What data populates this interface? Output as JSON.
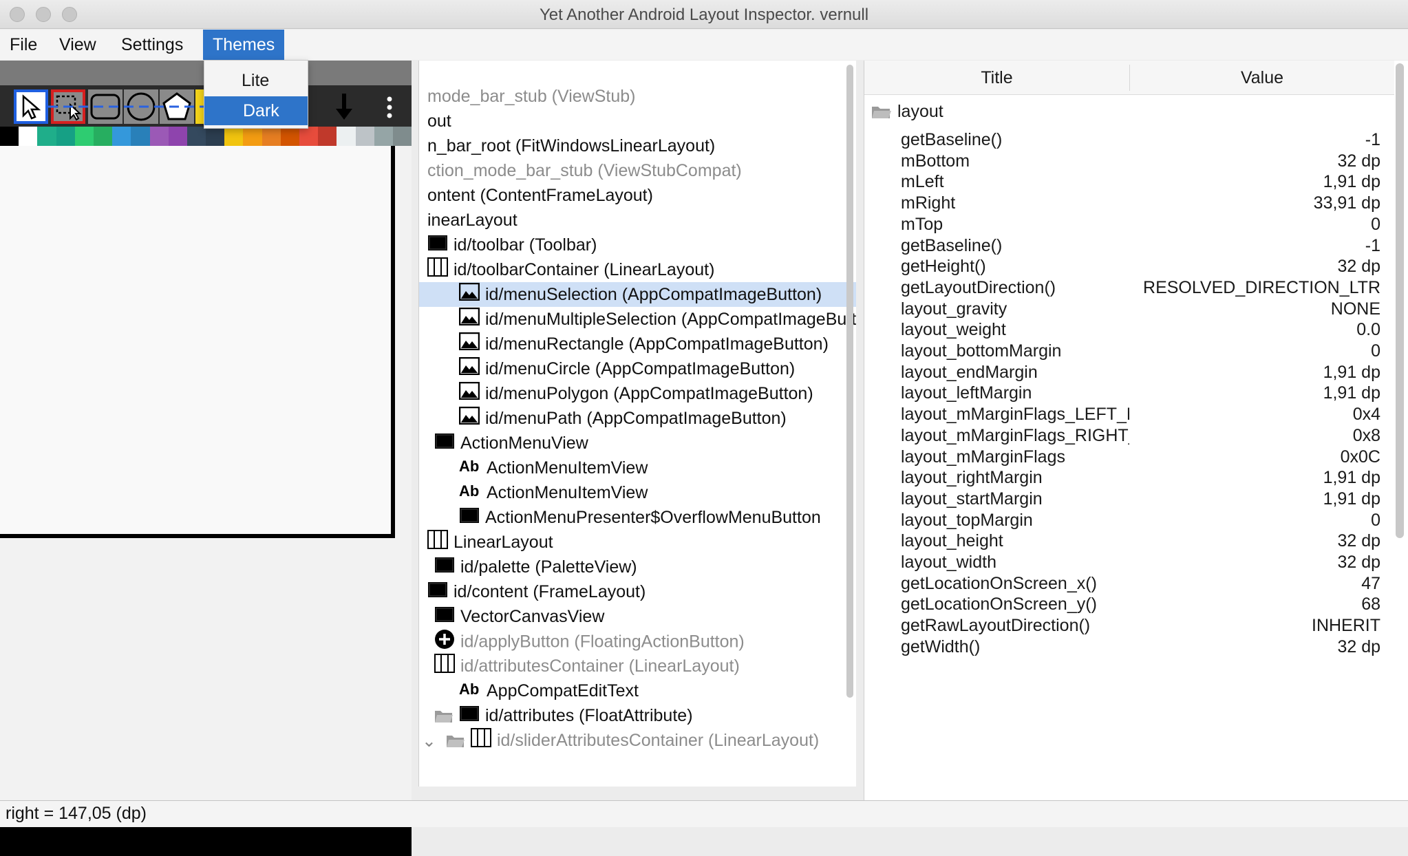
{
  "window": {
    "title": "Yet Another Android Layout Inspector. vernull"
  },
  "menubar": {
    "items": [
      "File",
      "View",
      "Settings",
      "Themes"
    ],
    "active": "Themes"
  },
  "themes_menu": {
    "items": [
      "Lite",
      "Dark"
    ],
    "selected": "Dark"
  },
  "palette_colors": [
    "#000000",
    "#ffffff",
    "#1fae8a",
    "#16a085",
    "#2ecc71",
    "#27ae60",
    "#3498db",
    "#2980b9",
    "#9b59b6",
    "#8e44ad",
    "#34495e",
    "#2c3e50",
    "#f1c40f",
    "#f39c12",
    "#e67e22",
    "#d35400",
    "#e74c3c",
    "#c0392b",
    "#ecf0f1",
    "#bdc3c7",
    "#95a5a6",
    "#7f8c8d"
  ],
  "tree": {
    "rows": [
      {
        "text": "mode_bar_stub (ViewStub)",
        "gray": true,
        "icon": ""
      },
      {
        "text": "out",
        "gray": false,
        "icon": ""
      },
      {
        "text": "n_bar_root (FitWindowsLinearLayout)",
        "gray": false,
        "icon": ""
      },
      {
        "text": "ction_mode_bar_stub (ViewStubCompat)",
        "gray": true,
        "icon": ""
      },
      {
        "text": "ontent (ContentFrameLayout)",
        "gray": false,
        "icon": ""
      },
      {
        "text": "inearLayout",
        "gray": false,
        "icon": ""
      },
      {
        "text": "id/toolbar (Toolbar)",
        "gray": false,
        "icon": "view-icon"
      },
      {
        "text": "id/toolbarContainer (LinearLayout)",
        "gray": false,
        "icon": "linear-layout-icon"
      },
      {
        "text": "id/menuSelection (AppCompatImageButton)",
        "gray": false,
        "icon": "image-icon",
        "selected": true
      },
      {
        "text": "id/menuMultipleSelection (AppCompatImageButton)",
        "gray": false,
        "icon": "image-icon"
      },
      {
        "text": "id/menuRectangle (AppCompatImageButton)",
        "gray": false,
        "icon": "image-icon"
      },
      {
        "text": "id/menuCircle (AppCompatImageButton)",
        "gray": false,
        "icon": "image-icon"
      },
      {
        "text": "id/menuPolygon (AppCompatImageButton)",
        "gray": false,
        "icon": "image-icon"
      },
      {
        "text": "id/menuPath (AppCompatImageButton)",
        "gray": false,
        "icon": "image-icon"
      },
      {
        "text": "ActionMenuView",
        "gray": false,
        "icon": "view-icon"
      },
      {
        "text": "ActionMenuItemView",
        "gray": false,
        "icon": "text-icon"
      },
      {
        "text": "ActionMenuItemView",
        "gray": false,
        "icon": "text-icon"
      },
      {
        "text": "ActionMenuPresenter$OverflowMenuButton",
        "gray": false,
        "icon": "view-icon"
      },
      {
        "text": "LinearLayout",
        "gray": false,
        "icon": "linear-layout-icon"
      },
      {
        "text": "id/palette (PaletteView)",
        "gray": false,
        "icon": "view-icon"
      },
      {
        "text": "id/content (FrameLayout)",
        "gray": false,
        "icon": "view-icon"
      },
      {
        "text": "VectorCanvasView",
        "gray": false,
        "icon": "view-icon"
      },
      {
        "text": "id/applyButton (FloatingActionButton)",
        "gray": true,
        "icon": "fab-icon"
      },
      {
        "text": "id/attributesContainer (LinearLayout)",
        "gray": true,
        "icon": "linear-layout-icon"
      },
      {
        "text": "AppCompatEditText",
        "gray": false,
        "icon": "text-icon"
      },
      {
        "text": "id/attributes (FloatAttribute)",
        "gray": false,
        "icon": "view-icon"
      },
      {
        "text": "id/sliderAttributesContainer (LinearLayout)",
        "gray": true,
        "icon": "linear-layout-icon"
      }
    ]
  },
  "props": {
    "header": {
      "title": "Title",
      "value": "Value"
    },
    "group": "layout",
    "rows": [
      {
        "name": "getBaseline()",
        "value": "-1"
      },
      {
        "name": "mBottom",
        "value": "32 dp"
      },
      {
        "name": "mLeft",
        "value": "1,91 dp"
      },
      {
        "name": "mRight",
        "value": "33,91 dp"
      },
      {
        "name": "mTop",
        "value": "0"
      },
      {
        "name": "getBaseline()",
        "value": "-1"
      },
      {
        "name": "getHeight()",
        "value": "32 dp"
      },
      {
        "name": "getLayoutDirection()",
        "value": "RESOLVED_DIRECTION_LTR"
      },
      {
        "name": "layout_gravity",
        "value": "NONE"
      },
      {
        "name": "layout_weight",
        "value": "0.0"
      },
      {
        "name": "layout_bottomMargin",
        "value": "0"
      },
      {
        "name": "layout_endMargin",
        "value": "1,91 dp"
      },
      {
        "name": "layout_leftMargin",
        "value": "1,91 dp"
      },
      {
        "name": "layout_mMarginFlags_LEFT_MARGIN",
        "value": "0x4"
      },
      {
        "name": "layout_mMarginFlags_RIGHT_MARGIN",
        "value": "0x8"
      },
      {
        "name": "layout_mMarginFlags",
        "value": "0x0C"
      },
      {
        "name": "layout_rightMargin",
        "value": "1,91 dp"
      },
      {
        "name": "layout_startMargin",
        "value": "1,91 dp"
      },
      {
        "name": "layout_topMargin",
        "value": "0"
      },
      {
        "name": "layout_height",
        "value": "32 dp"
      },
      {
        "name": "layout_width",
        "value": "32 dp"
      },
      {
        "name": "getLocationOnScreen_x()",
        "value": "47"
      },
      {
        "name": "getLocationOnScreen_y()",
        "value": "68"
      },
      {
        "name": "getRawLayoutDirection()",
        "value": "INHERIT"
      },
      {
        "name": "getWidth()",
        "value": "32 dp"
      }
    ]
  },
  "status": {
    "text": "right = 147,05 (dp)"
  }
}
